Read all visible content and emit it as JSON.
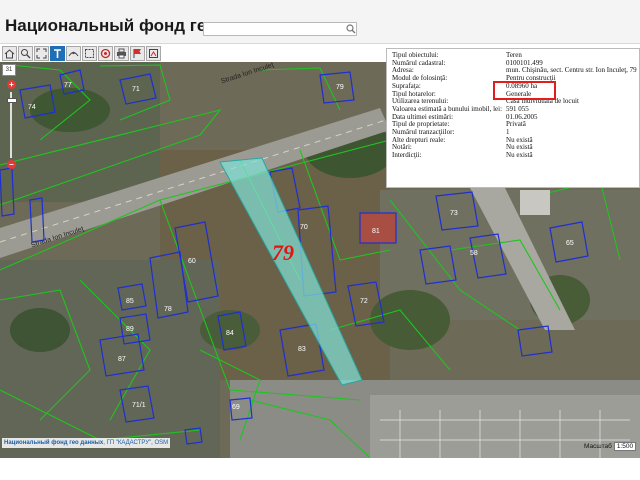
{
  "app": {
    "title": "Национальный фонд гео данных",
    "search_placeholder": ""
  },
  "toolbar": {
    "tools": [
      "home-icon",
      "zoom-in-area-icon",
      "extent-icon",
      "text-tool-icon",
      "measure-icon",
      "selection-icon",
      "target-icon",
      "print-icon",
      "flag-icon",
      "export-icon"
    ]
  },
  "zoom": {
    "level": "31",
    "plus_label": "+",
    "minus_label": "–"
  },
  "map": {
    "street_label_1": "Strada Ion Inculeţ",
    "street_label_2": "Strada Ion Inculeţ",
    "parcel_number": "79",
    "building_labels": [
      "74",
      "77",
      "71",
      "79",
      "70",
      "60",
      "78",
      "85",
      "89",
      "87",
      "84",
      "83",
      "81",
      "72",
      "73",
      "65",
      "58",
      "71/1",
      "69"
    ]
  },
  "info_panel": {
    "rows": [
      {
        "key": "Tipul obiectului:",
        "value": "Teren"
      },
      {
        "key": "Numărul cadastral:",
        "value": "0100101.499"
      },
      {
        "key": "Adresa:",
        "value": "mun. Chişinău, sect. Centru str. Ion Inculeţ, 79"
      },
      {
        "key": "Modul de folosinţă:",
        "value": "Pentru construcţii"
      },
      {
        "key": "Suprafaţa:",
        "value": "0.08960 ha"
      },
      {
        "key": "Tipul hotarelor:",
        "value": "Generale"
      },
      {
        "key": "Utilizarea terenului:",
        "value": "Casă individuală de locuit"
      },
      {
        "key": "Valoarea estimată a bunului imobil, lei:",
        "value": "591 055"
      },
      {
        "key": "Data ultimei estimări:",
        "value": "01.06.2005"
      },
      {
        "key": "Tipul de proprietate:",
        "value": "Privată"
      },
      {
        "key": "Numărul tranzacţiilor:",
        "value": "1"
      },
      {
        "key": "Alte drepturi reale:",
        "value": "Nu există"
      },
      {
        "key": "Notări:",
        "value": "Nu există"
      },
      {
        "key": "Interdicţii:",
        "value": "Nu există"
      }
    ]
  },
  "credits": {
    "source": "Национальный фонд гео данных",
    "extra": ", ГП \"КАДАСТРУ\", OSM"
  },
  "scale": {
    "label": "Масштаб",
    "value": "1:500"
  },
  "colors": {
    "parcel_highlight": "#7fe0d6",
    "building_outline": "#1f2fd0",
    "parcel_outline": "#20c020",
    "highlight_red": "#e01e1e"
  }
}
